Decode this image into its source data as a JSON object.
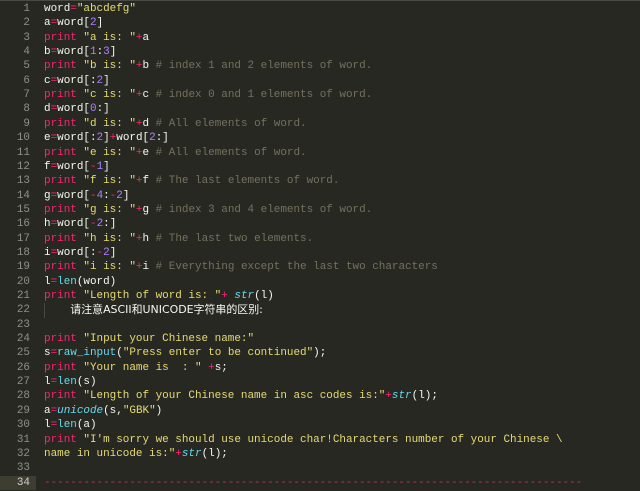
{
  "editor": {
    "current_line": 34,
    "colors": {
      "background": "#272822",
      "keyword": "#f92672",
      "string": "#e6db74",
      "number": "#ae81ff",
      "comment": "#75715e",
      "function": "#66d9ef"
    },
    "lines": [
      {
        "num": "1",
        "tokens": [
          [
            "t",
            "word"
          ],
          [
            "o",
            "="
          ],
          [
            "s",
            "\"abcdefg\""
          ]
        ]
      },
      {
        "num": "2",
        "tokens": [
          [
            "t",
            "a"
          ],
          [
            "o",
            "="
          ],
          [
            "t",
            "word["
          ],
          [
            "n",
            "2"
          ],
          [
            "t",
            "]"
          ]
        ]
      },
      {
        "num": "3",
        "tokens": [
          [
            "k",
            "print"
          ],
          [
            "t",
            " "
          ],
          [
            "s",
            "\"a is: \""
          ],
          [
            "o",
            "+"
          ],
          [
            "t",
            "a"
          ]
        ]
      },
      {
        "num": "4",
        "tokens": [
          [
            "t",
            "b"
          ],
          [
            "o",
            "="
          ],
          [
            "t",
            "word["
          ],
          [
            "n",
            "1"
          ],
          [
            "t",
            ":"
          ],
          [
            "n",
            "3"
          ],
          [
            "t",
            "]"
          ]
        ]
      },
      {
        "num": "5",
        "tokens": [
          [
            "k",
            "print"
          ],
          [
            "t",
            " "
          ],
          [
            "s",
            "\"b is: \""
          ],
          [
            "o",
            "+"
          ],
          [
            "t",
            "b "
          ],
          [
            "c",
            "# index 1 and 2 elements of word."
          ]
        ]
      },
      {
        "num": "6",
        "tokens": [
          [
            "t",
            "c"
          ],
          [
            "o",
            "="
          ],
          [
            "t",
            "word[:"
          ],
          [
            "n",
            "2"
          ],
          [
            "t",
            "]"
          ]
        ]
      },
      {
        "num": "7",
        "tokens": [
          [
            "k",
            "print"
          ],
          [
            "t",
            " "
          ],
          [
            "s",
            "\"c is: \""
          ],
          [
            "o",
            "+"
          ],
          [
            "t",
            "c "
          ],
          [
            "c",
            "# index 0 and 1 elements of word."
          ]
        ]
      },
      {
        "num": "8",
        "tokens": [
          [
            "t",
            "d"
          ],
          [
            "o",
            "="
          ],
          [
            "t",
            "word["
          ],
          [
            "n",
            "0"
          ],
          [
            "t",
            ":]"
          ]
        ]
      },
      {
        "num": "9",
        "tokens": [
          [
            "k",
            "print"
          ],
          [
            "t",
            " "
          ],
          [
            "s",
            "\"d is: \""
          ],
          [
            "o",
            "+"
          ],
          [
            "t",
            "d "
          ],
          [
            "c",
            "# All elements of word."
          ]
        ]
      },
      {
        "num": "10",
        "tokens": [
          [
            "t",
            "e"
          ],
          [
            "o",
            "="
          ],
          [
            "t",
            "word[:"
          ],
          [
            "n",
            "2"
          ],
          [
            "t",
            "]"
          ],
          [
            "o",
            "+"
          ],
          [
            "t",
            "word["
          ],
          [
            "n",
            "2"
          ],
          [
            "t",
            ":]"
          ]
        ]
      },
      {
        "num": "11",
        "tokens": [
          [
            "k",
            "print"
          ],
          [
            "t",
            " "
          ],
          [
            "s",
            "\"e is: \""
          ],
          [
            "o",
            "+"
          ],
          [
            "t",
            "e "
          ],
          [
            "c",
            "# All elements of word."
          ]
        ]
      },
      {
        "num": "12",
        "tokens": [
          [
            "t",
            "f"
          ],
          [
            "o",
            "="
          ],
          [
            "t",
            "word["
          ],
          [
            "o",
            "-"
          ],
          [
            "n",
            "1"
          ],
          [
            "t",
            "]"
          ]
        ]
      },
      {
        "num": "13",
        "tokens": [
          [
            "k",
            "print"
          ],
          [
            "t",
            " "
          ],
          [
            "s",
            "\"f is: \""
          ],
          [
            "o",
            "+"
          ],
          [
            "t",
            "f "
          ],
          [
            "c",
            "# The last elements of word."
          ]
        ]
      },
      {
        "num": "14",
        "tokens": [
          [
            "t",
            "g"
          ],
          [
            "o",
            "="
          ],
          [
            "t",
            "word["
          ],
          [
            "o",
            "-"
          ],
          [
            "n",
            "4"
          ],
          [
            "t",
            ":"
          ],
          [
            "o",
            "-"
          ],
          [
            "n",
            "2"
          ],
          [
            "t",
            "]"
          ]
        ]
      },
      {
        "num": "15",
        "tokens": [
          [
            "k",
            "print"
          ],
          [
            "t",
            " "
          ],
          [
            "s",
            "\"g is: \""
          ],
          [
            "o",
            "+"
          ],
          [
            "t",
            "g "
          ],
          [
            "c",
            "# index 3 and 4 elements of word."
          ]
        ]
      },
      {
        "num": "16",
        "tokens": [
          [
            "t",
            "h"
          ],
          [
            "o",
            "="
          ],
          [
            "t",
            "word["
          ],
          [
            "o",
            "-"
          ],
          [
            "n",
            "2"
          ],
          [
            "t",
            ":]"
          ]
        ]
      },
      {
        "num": "17",
        "tokens": [
          [
            "k",
            "print"
          ],
          [
            "t",
            " "
          ],
          [
            "s",
            "\"h is: \""
          ],
          [
            "o",
            "+"
          ],
          [
            "t",
            "h "
          ],
          [
            "c",
            "# The last two elements."
          ]
        ]
      },
      {
        "num": "18",
        "tokens": [
          [
            "t",
            "i"
          ],
          [
            "o",
            "="
          ],
          [
            "t",
            "word[:"
          ],
          [
            "o",
            "-"
          ],
          [
            "n",
            "2"
          ],
          [
            "t",
            "]"
          ]
        ]
      },
      {
        "num": "19",
        "tokens": [
          [
            "k",
            "print"
          ],
          [
            "t",
            " "
          ],
          [
            "s",
            "\"i is: \""
          ],
          [
            "o",
            "+"
          ],
          [
            "t",
            "i "
          ],
          [
            "c",
            "# Everything except the last two characters"
          ]
        ]
      },
      {
        "num": "20",
        "tokens": [
          [
            "t",
            "l"
          ],
          [
            "o",
            "="
          ],
          [
            "f",
            "len"
          ],
          [
            "t",
            "(word)"
          ]
        ]
      },
      {
        "num": "21",
        "tokens": [
          [
            "k",
            "print"
          ],
          [
            "t",
            " "
          ],
          [
            "s",
            "\"Length of word is: \""
          ],
          [
            "o",
            "+"
          ],
          [
            "t",
            " "
          ],
          [
            "fi",
            "str"
          ],
          [
            "t",
            "(l)"
          ]
        ]
      },
      {
        "num": "22",
        "guide": true,
        "tokens": [
          [
            "t",
            "    "
          ],
          [
            "z",
            "请注意ASCII和UNICODE字符串的区别:"
          ]
        ]
      },
      {
        "num": "23",
        "tokens": []
      },
      {
        "num": "24",
        "tokens": [
          [
            "k",
            "print"
          ],
          [
            "t",
            " "
          ],
          [
            "s",
            "\"Input your Chinese name:\""
          ]
        ]
      },
      {
        "num": "25",
        "tokens": [
          [
            "t",
            "s"
          ],
          [
            "o",
            "="
          ],
          [
            "f",
            "raw_input"
          ],
          [
            "t",
            "("
          ],
          [
            "s",
            "\"Press enter to be continued\""
          ],
          [
            "t",
            ");"
          ]
        ]
      },
      {
        "num": "26",
        "tokens": [
          [
            "k",
            "print"
          ],
          [
            "t",
            " "
          ],
          [
            "s",
            "\"Your name is  : \""
          ],
          [
            "t",
            " "
          ],
          [
            "o",
            "+"
          ],
          [
            "t",
            "s;"
          ]
        ]
      },
      {
        "num": "27",
        "tokens": [
          [
            "t",
            "l"
          ],
          [
            "o",
            "="
          ],
          [
            "f",
            "len"
          ],
          [
            "t",
            "(s)"
          ]
        ]
      },
      {
        "num": "28",
        "tokens": [
          [
            "k",
            "print"
          ],
          [
            "t",
            " "
          ],
          [
            "s",
            "\"Length of your Chinese name in asc codes is:\""
          ],
          [
            "o",
            "+"
          ],
          [
            "fi",
            "str"
          ],
          [
            "t",
            "(l);"
          ]
        ]
      },
      {
        "num": "29",
        "tokens": [
          [
            "t",
            "a"
          ],
          [
            "o",
            "="
          ],
          [
            "fi",
            "unicode"
          ],
          [
            "t",
            "(s,"
          ],
          [
            "s",
            "\"GBK\""
          ],
          [
            "t",
            ")"
          ]
        ]
      },
      {
        "num": "30",
        "tokens": [
          [
            "t",
            "l"
          ],
          [
            "o",
            "="
          ],
          [
            "f",
            "len"
          ],
          [
            "t",
            "(a)"
          ]
        ]
      },
      {
        "num": "31",
        "tokens": [
          [
            "k",
            "print"
          ],
          [
            "t",
            " "
          ],
          [
            "s",
            "\"I'm sorry we should use unicode char!Characters number of your Chinese \\"
          ]
        ]
      },
      {
        "num": "32",
        "tokens": [
          [
            "s",
            "name in unicode is:\""
          ],
          [
            "o",
            "+"
          ],
          [
            "fi",
            "str"
          ],
          [
            "t",
            "(l);"
          ]
        ]
      },
      {
        "num": "33",
        "tokens": []
      },
      {
        "num": "34",
        "tokens": [
          [
            "d",
            "----------------------------------------------------------------------------------"
          ]
        ]
      }
    ]
  }
}
